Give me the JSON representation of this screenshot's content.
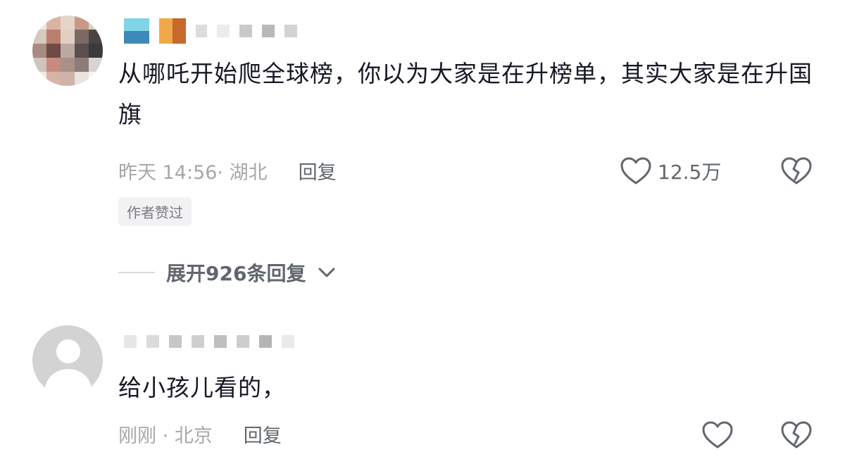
{
  "comments": [
    {
      "text": "从哪吒开始爬全球榜，你以为大家是在升榜单，其实大家是在升国旗",
      "time": "昨天 14:56",
      "location_sep": "· 湖北",
      "reply_label": "回复",
      "like_count": "12.5万",
      "badge": "作者赞过",
      "expand_label": "展开926条回复",
      "avatar": "pixelated-avatar",
      "icons": {
        "like": "heart-outline-icon",
        "dislike": "broken-heart-icon",
        "expand": "chevron-down-icon"
      }
    },
    {
      "text": "给小孩儿看的，",
      "time": "刚刚",
      "location_sep": "· 北京",
      "reply_label": "回复",
      "avatar": "default-avatar",
      "icons": {
        "like": "heart-outline-icon",
        "dislike": "broken-heart-icon"
      }
    }
  ],
  "colors": {
    "text_primary": "#161823",
    "text_meta": "#a7a7aa",
    "text_secondary": "#61666d"
  }
}
